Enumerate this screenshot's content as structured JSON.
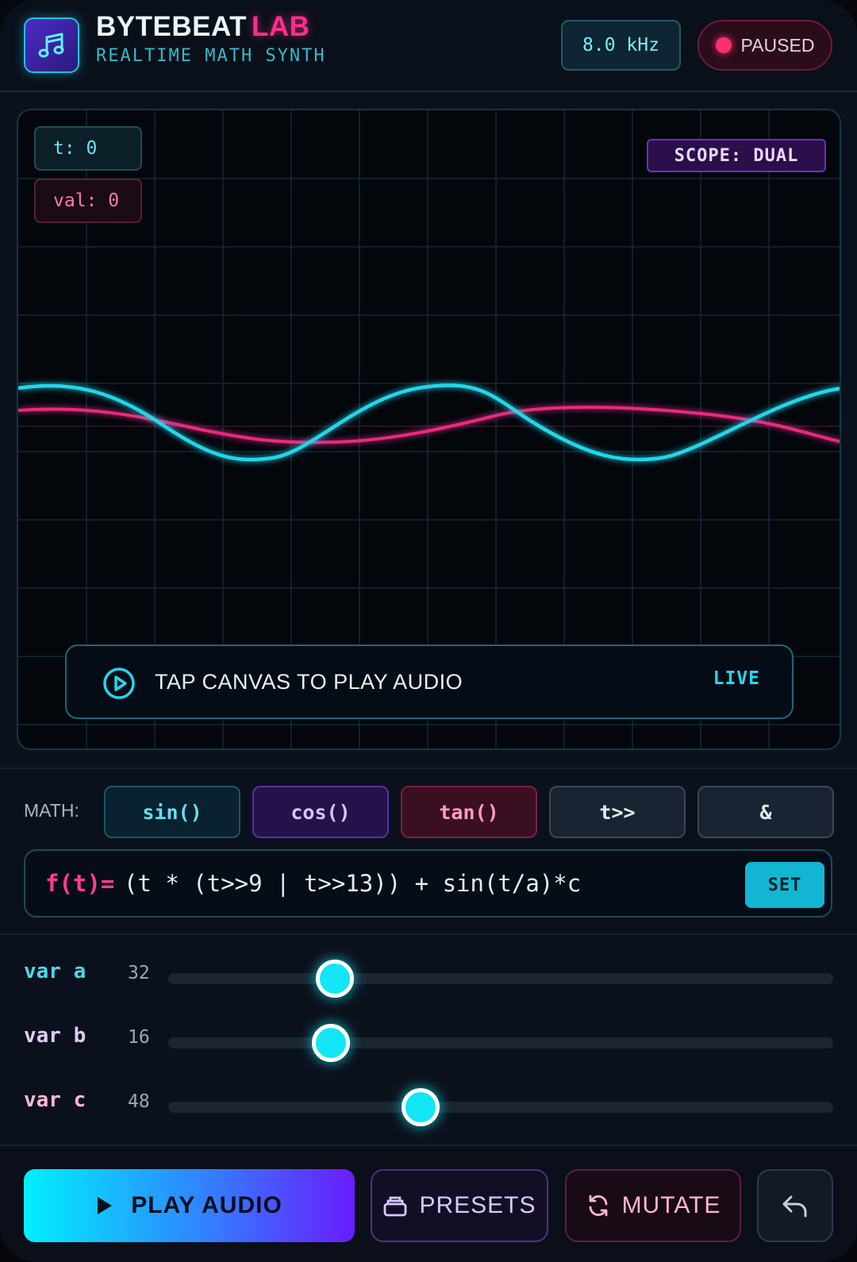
{
  "header": {
    "title_main": "BYTEBEAT",
    "title_accent": "LAB",
    "subtitle": "REALTIME MATH SYNTH",
    "logo_icon": "music-note-icon",
    "sample_rate": "8.0 kHz",
    "status": "PAUSED"
  },
  "scope": {
    "t_readout": "t: 0",
    "val_readout": "val: 0",
    "mode_badge": "SCOPE: DUAL",
    "tap_prompt": "TAP CANVAS TO PLAY AUDIO",
    "live_label": "LIVE",
    "tap_icon": "play-circle-icon"
  },
  "math": {
    "label": "MATH:",
    "buttons": [
      "sin()",
      "cos()",
      "tan()",
      "t>>",
      "&"
    ]
  },
  "formula": {
    "label": "f(t)=",
    "expression": "(t * (t>>9 | t>>13)) + sin(t/a)*c",
    "set_label": "SET"
  },
  "variables": [
    {
      "label": "var a",
      "value": "32",
      "fraction": 0.25,
      "color": "#4fd6ec"
    },
    {
      "label": "var b",
      "value": "16",
      "fraction": 0.245,
      "color": "#e5c8ff"
    },
    {
      "label": "var c",
      "value": "48",
      "fraction": 0.38,
      "color": "#ffb7d2"
    }
  ],
  "actions": {
    "play": "PLAY AUDIO",
    "presets": "PRESETS",
    "mutate": "MUTATE",
    "undo_icon": "undo-icon"
  },
  "colors": {
    "accent_cyan": "#12e6f4",
    "accent_pink": "#ff2e8c",
    "accent_purple": "#6a1cff"
  }
}
